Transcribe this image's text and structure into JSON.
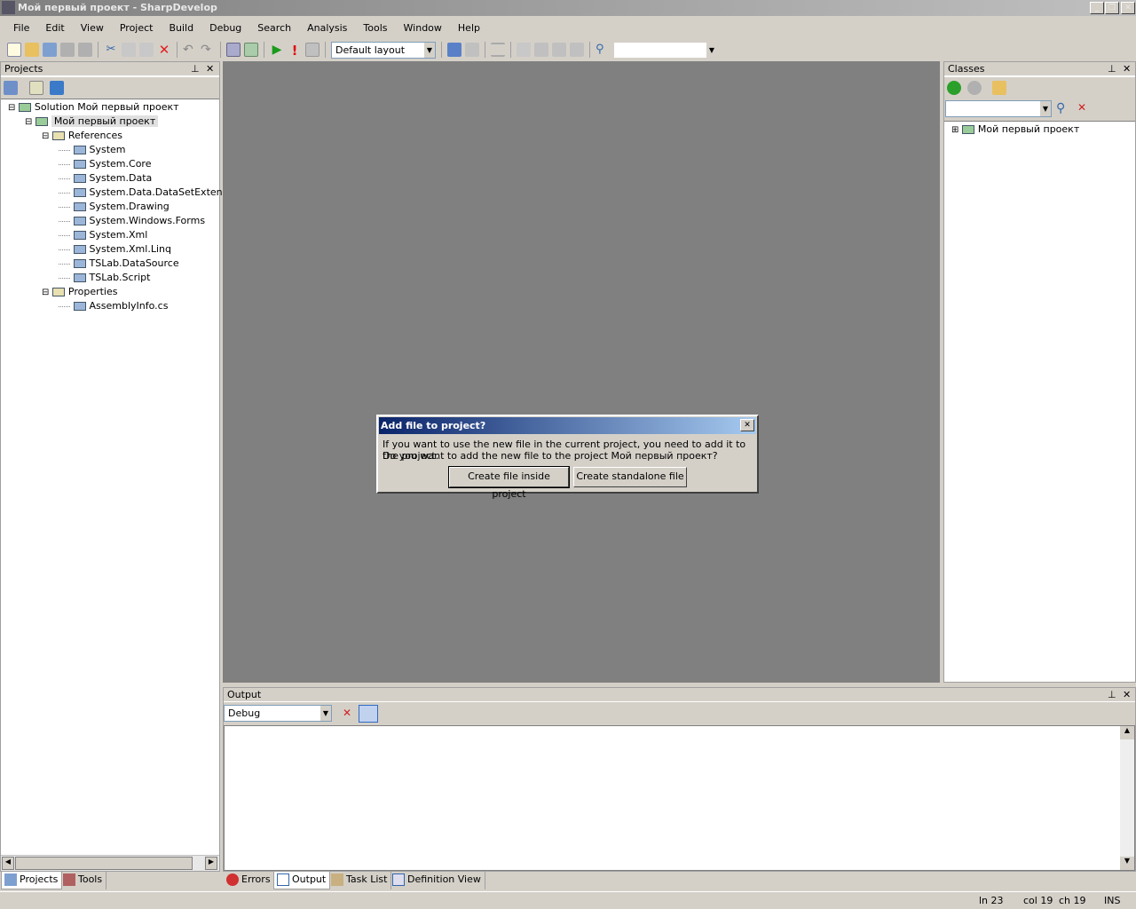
{
  "window": {
    "title": "Мой первый проект - SharpDevelop"
  },
  "menu": [
    "File",
    "Edit",
    "View",
    "Project",
    "Build",
    "Debug",
    "Search",
    "Analysis",
    "Tools",
    "Window",
    "Help"
  ],
  "toolbar": {
    "layout": "Default layout",
    "search": ""
  },
  "projects": {
    "title": "Projects",
    "tree": [
      {
        "label": "Solution Мой первый проект",
        "level": 0,
        "toggle": "⊟"
      },
      {
        "label": "Мой первый проект",
        "level": 1,
        "toggle": "⊟"
      },
      {
        "label": "References",
        "level": 2,
        "toggle": "⊟"
      },
      {
        "label": "System",
        "level": 3
      },
      {
        "label": "System.Core",
        "level": 3
      },
      {
        "label": "System.Data",
        "level": 3
      },
      {
        "label": "System.Data.DataSetExtensio",
        "level": 3
      },
      {
        "label": "System.Drawing",
        "level": 3
      },
      {
        "label": "System.Windows.Forms",
        "level": 3
      },
      {
        "label": "System.Xml",
        "level": 3
      },
      {
        "label": "System.Xml.Linq",
        "level": 3
      },
      {
        "label": "TSLab.DataSource",
        "level": 3
      },
      {
        "label": "TSLab.Script",
        "level": 3
      },
      {
        "label": "Properties",
        "level": 2,
        "toggle": "⊟"
      },
      {
        "label": "AssemblyInfo.cs",
        "level": 3
      }
    ]
  },
  "classes": {
    "title": "Classes",
    "tree": [
      "Мой первый проект"
    ]
  },
  "output": {
    "title": "Output",
    "source": "Debug"
  },
  "dialog": {
    "title": "Add file to project?",
    "line1": "If you want to use the new file in the current project, you need to add it to the project.",
    "line2": "Do you want to add the new file to the project Мой первый проект?",
    "btn_inside": "Create file inside project",
    "btn_standalone": "Create standalone file"
  },
  "left_tabs": [
    "Projects",
    "Tools"
  ],
  "bottom_tabs": [
    "Errors",
    "Output",
    "Task List",
    "Definition View"
  ],
  "status": {
    "ln": "ln 23",
    "col": "col 19",
    "ch": "ch 19",
    "mode": "INS"
  }
}
